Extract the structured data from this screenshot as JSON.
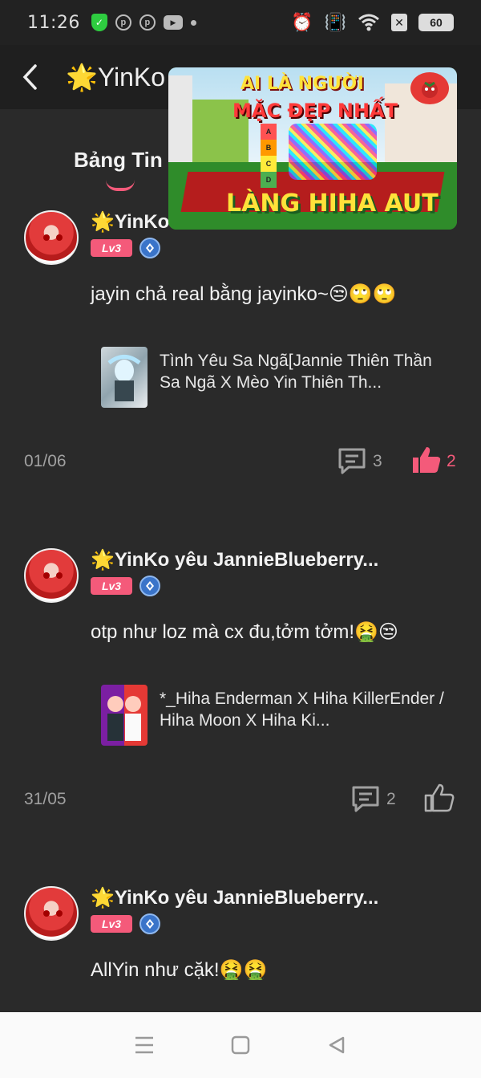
{
  "status_bar": {
    "time": "11:26",
    "battery": "60"
  },
  "header": {
    "title": "🌟YinKo y",
    "back_icon": "chevron-left-icon"
  },
  "tabs": {
    "active_label": "Bảng Tin"
  },
  "video_overlay": {
    "line1": "AI LÀ NGƯỜI",
    "line2": "MẶC ĐẸP NHẤT",
    "line3": "LÀNG HIHA AUT",
    "tiers": [
      "A",
      "B",
      "C",
      "D"
    ]
  },
  "posts": [
    {
      "author": "🌟YinKo",
      "level": "Lv3",
      "text": "jayin chả real bằng jayinko~😒🙄🙄",
      "linked_title": "Tình Yêu Sa Ngã[Jannie Thiên Thần Sa Ngã X Mèo Yin Thiên Th...",
      "date": "01/06",
      "comments": "3",
      "likes": "2",
      "liked": true
    },
    {
      "author": "🌟YinKo yêu JannieBlueberry...",
      "level": "Lv3",
      "text": "otp như loz mà cx đu,tởm tởm!🤮😒",
      "linked_title": "*_Hiha Enderman X Hiha KillerEnder / Hiha Moon X Hiha Ki...",
      "date": "31/05",
      "comments": "2",
      "likes": "",
      "liked": false
    },
    {
      "author": "🌟YinKo yêu JannieBlueberry...",
      "level": "Lv3",
      "text": "AllYin như cặk!🤮🤮"
    }
  ],
  "colors": {
    "accent": "#f45a7a",
    "background": "#2a2a2a",
    "header": "#1f1f1f"
  }
}
